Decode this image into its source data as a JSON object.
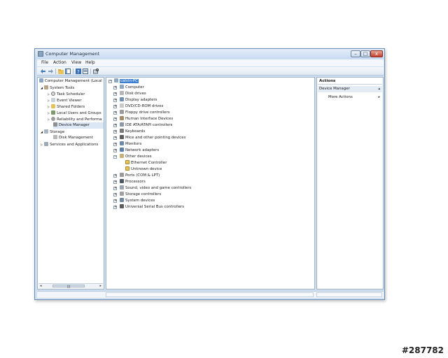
{
  "window": {
    "title": "Computer Management",
    "controls": {
      "minimize": "–",
      "maximize": "□",
      "close": "x"
    }
  },
  "menubar": [
    "File",
    "Action",
    "View",
    "Help"
  ],
  "toolbar_icons": [
    "back-arrow-icon",
    "forward-arrow-icon",
    "up-folder-icon",
    "show-hide-tree-icon",
    "help-icon",
    "properties-icon",
    "scan-hardware-icon"
  ],
  "left_tree": [
    {
      "label": "Computer Management (Local",
      "level": 0,
      "icon": "computer-management-icon"
    },
    {
      "label": "System Tools",
      "level": 1,
      "expander": "◢",
      "icon": "tools-icon"
    },
    {
      "label": "Task Scheduler",
      "level": 2,
      "expander": "▷",
      "icon": "clock-icon"
    },
    {
      "label": "Event Viewer",
      "level": 2,
      "expander": "▷",
      "icon": "event-viewer-icon"
    },
    {
      "label": "Shared Folders",
      "level": 2,
      "expander": "▷",
      "icon": "folder-icon"
    },
    {
      "label": "Local Users and Groups",
      "level": 2,
      "expander": "▷",
      "icon": "users-icon"
    },
    {
      "label": "Reliability and Performa",
      "level": 2,
      "expander": "▷",
      "icon": "performance-icon"
    },
    {
      "label": "Device Manager",
      "level": 2,
      "icon": "device-manager-icon",
      "highlight": true
    },
    {
      "label": "Storage",
      "level": 1,
      "expander": "◢",
      "icon": "storage-icon"
    },
    {
      "label": "Disk Management",
      "level": 2,
      "icon": "disk-icon"
    },
    {
      "label": "Services and Applications",
      "level": 1,
      "expander": "▷",
      "icon": "services-icon"
    }
  ],
  "scrollbar": {
    "thumb_grip": "|||",
    "left_arrow": "◂",
    "right_arrow": "▸"
  },
  "device_tree": {
    "root": "calvin-PC",
    "categories": [
      {
        "label": "Computer",
        "expander": "+",
        "icon": "computer-icon"
      },
      {
        "label": "Disk drives",
        "expander": "+",
        "icon": "disk-drive-icon"
      },
      {
        "label": "Display adapters",
        "expander": "+",
        "icon": "display-adapter-icon"
      },
      {
        "label": "DVD/CD-ROM drives",
        "expander": "+",
        "icon": "dvd-icon"
      },
      {
        "label": "Floppy drive controllers",
        "expander": "+",
        "icon": "floppy-icon"
      },
      {
        "label": "Human Interface Devices",
        "expander": "+",
        "icon": "hid-icon"
      },
      {
        "label": "IDE ATA/ATAPI controllers",
        "expander": "+",
        "icon": "ide-icon"
      },
      {
        "label": "Keyboards",
        "expander": "+",
        "icon": "keyboard-icon"
      },
      {
        "label": "Mice and other pointing devices",
        "expander": "+",
        "icon": "mouse-icon"
      },
      {
        "label": "Monitors",
        "expander": "+",
        "icon": "monitor-icon"
      },
      {
        "label": "Network adapters",
        "expander": "+",
        "icon": "network-icon"
      },
      {
        "label": "Other devices",
        "expander": "−",
        "icon": "unknown-device-icon",
        "children": [
          {
            "label": "Ethernet Controller",
            "icon": "warning-device-icon"
          },
          {
            "label": "Unknown device",
            "icon": "warning-device-icon"
          }
        ]
      },
      {
        "label": "Ports (COM & LPT)",
        "expander": "+",
        "icon": "port-icon"
      },
      {
        "label": "Processors",
        "expander": "+",
        "icon": "processor-icon"
      },
      {
        "label": "Sound, video and game controllers",
        "expander": "+",
        "icon": "sound-icon"
      },
      {
        "label": "Storage controllers",
        "expander": "+",
        "icon": "storage-controller-icon"
      },
      {
        "label": "System devices",
        "expander": "+",
        "icon": "system-device-icon"
      },
      {
        "label": "Universal Serial Bus controllers",
        "expander": "+",
        "icon": "usb-icon"
      }
    ]
  },
  "actions": {
    "header": "Actions",
    "section": "Device Manager",
    "section_arrow": "▴",
    "item": "More Actions",
    "item_arrow": "▸"
  },
  "watermark": "#287782",
  "colors": {
    "selection": "#3b7fd1",
    "window_frame": "#cfe0f2",
    "close_button": "#c2402c"
  }
}
